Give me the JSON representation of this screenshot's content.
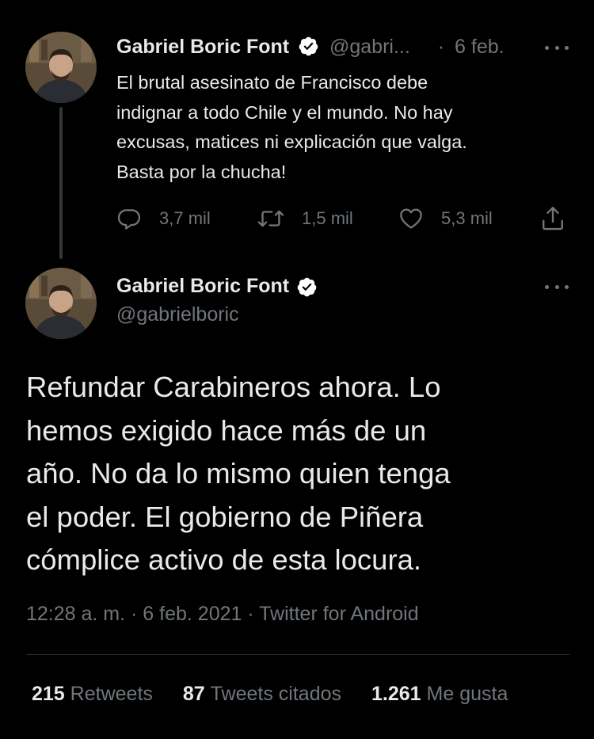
{
  "colors": {
    "background": "#000000",
    "text": "#e7e9ea",
    "secondary": "#71767b",
    "verified_badge": "#ffffff"
  },
  "parent_tweet": {
    "author_name": "Gabriel Boric Font",
    "handle": "@gabri...",
    "separator": "·",
    "date": "6 feb.",
    "text": "El brutal asesinato de Francisco debe\nindignar a todo Chile y el mundo. No hay\nexcusas, matices ni explicación que valga.\nBasta por la chucha!",
    "replies": "3,7 mil",
    "retweets": "1,5 mil",
    "likes": "5,3 mil",
    "icons": [
      "reply-icon",
      "retweet-icon",
      "like-icon",
      "share-icon",
      "more-icon",
      "verified-icon"
    ]
  },
  "main_tweet": {
    "author_name": "Gabriel Boric Font",
    "handle": "@gabrielboric",
    "text": "Refundar Carabineros ahora. Lo\nhemos exigido hace más de un\naño. No da lo mismo quien tenga\nel poder. El gobierno de Piñera\ncómplice activo de esta locura.",
    "meta": "12:28 a. m. · 6 feb. 2021 · Twitter for Android",
    "stats": {
      "retweets_count": "215",
      "retweets_label": "Retweets",
      "quotes_count": "87",
      "quotes_label": "Tweets citados",
      "likes_count": "1.261",
      "likes_label": "Me gusta"
    }
  }
}
